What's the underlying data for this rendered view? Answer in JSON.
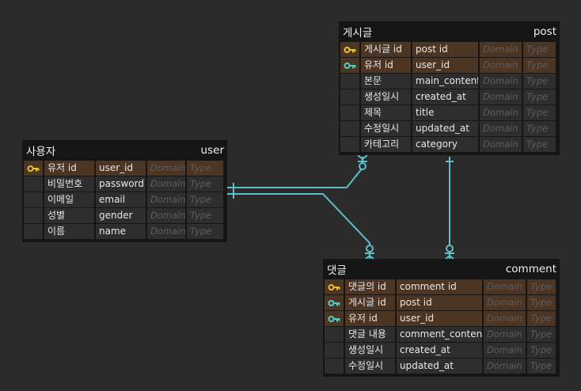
{
  "colors": {
    "background": "#2b2b2b",
    "entity": "#151515",
    "key_row": "#4d3524",
    "row": "#2e2e2e",
    "connector": "#5fbfc9",
    "pk_icon": "#e8c22c",
    "fk_icon": "#4fd1c5"
  },
  "entities": [
    {
      "id": "post",
      "title": "게시글",
      "name": "post",
      "columns": [
        {
          "label": "게시글 id",
          "name": "post id",
          "key": "pk",
          "domain": "Domain",
          "type": "Type"
        },
        {
          "label": "유저 id",
          "name": "user_id",
          "key": "fk",
          "domain": "Domain",
          "type": "Type"
        },
        {
          "label": "본문",
          "name": "main_content",
          "key": "",
          "domain": "Domain",
          "type": "Type"
        },
        {
          "label": "생성일시",
          "name": "created_at",
          "key": "",
          "domain": "Domain",
          "type": "Type"
        },
        {
          "label": "제목",
          "name": "title",
          "key": "",
          "domain": "Domain",
          "type": "Type"
        },
        {
          "label": "수정일시",
          "name": "updated_at",
          "key": "",
          "domain": "Domain",
          "type": "Type"
        },
        {
          "label": "카테고리",
          "name": "category",
          "key": "",
          "domain": "Domain",
          "type": "Type"
        }
      ]
    },
    {
      "id": "user",
      "title": "사용자",
      "name": "user",
      "columns": [
        {
          "label": "유저 id",
          "name": "user_id",
          "key": "pk",
          "domain": "Domain",
          "type": "Type"
        },
        {
          "label": "비밀번호",
          "name": "password",
          "key": "",
          "domain": "Domain",
          "type": "Type"
        },
        {
          "label": "이메일",
          "name": "email",
          "key": "",
          "domain": "Domain",
          "type": "Type"
        },
        {
          "label": "성별",
          "name": "gender",
          "key": "",
          "domain": "Domain",
          "type": "Type"
        },
        {
          "label": "이름",
          "name": "name",
          "key": "",
          "domain": "Domain",
          "type": "Type"
        }
      ]
    },
    {
      "id": "comment",
      "title": "댓글",
      "name": "comment",
      "columns": [
        {
          "label": "댓글의 id",
          "name": "comment id",
          "key": "pk",
          "domain": "Domain",
          "type": "Type"
        },
        {
          "label": "게시글 id",
          "name": "post id",
          "key": "fk",
          "domain": "Domain",
          "type": "Type"
        },
        {
          "label": "유저 id",
          "name": "user_id",
          "key": "fk",
          "domain": "Domain",
          "type": "Type"
        },
        {
          "label": "댓글 내용",
          "name": "comment_content",
          "key": "",
          "domain": "Domain",
          "type": "Type"
        },
        {
          "label": "생성일시",
          "name": "created_at",
          "key": "",
          "domain": "Domain",
          "type": "Type"
        },
        {
          "label": "수정일시",
          "name": "updated_at",
          "key": "",
          "domain": "Domain",
          "type": "Type"
        }
      ]
    }
  ],
  "relationships": [
    {
      "from": "user",
      "to": "post",
      "from_cardinality": "one",
      "to_cardinality": "zero-or-many"
    },
    {
      "from": "user",
      "to": "comment",
      "from_cardinality": "one",
      "to_cardinality": "zero-or-many"
    },
    {
      "from": "post",
      "to": "comment",
      "from_cardinality": "one",
      "to_cardinality": "zero-or-many"
    }
  ]
}
